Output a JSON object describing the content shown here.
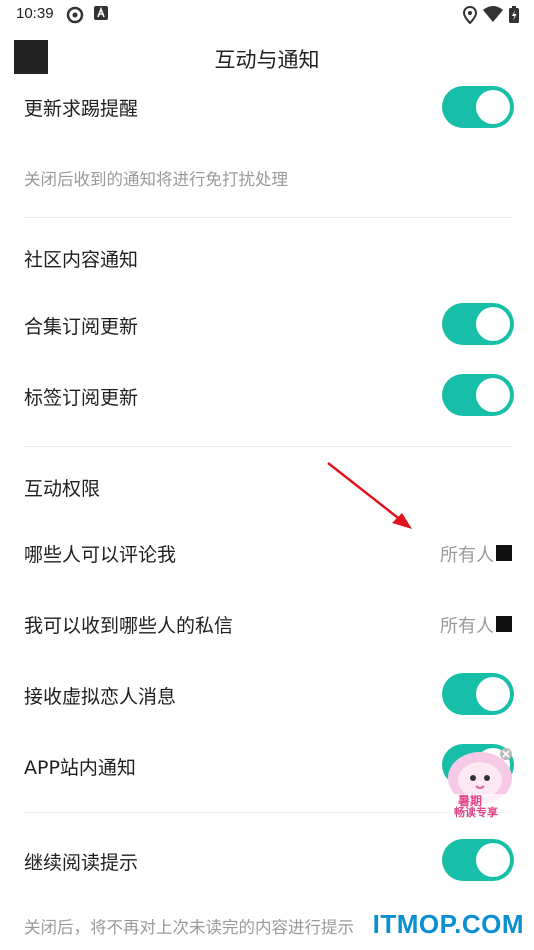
{
  "status_bar": {
    "time": "10:39"
  },
  "header": {
    "title": "互动与通知"
  },
  "rows": {
    "update_reminder": {
      "label": "更新求踢提醒",
      "on": true
    },
    "update_hint": "关闭后收到的通知将进行免打扰处理",
    "community_section": "社区内容通知",
    "collection_update": {
      "label": "合集订阅更新",
      "on": true
    },
    "tag_update": {
      "label": "标签订阅更新",
      "on": true
    },
    "interaction_section": "互动权限",
    "who_can_comment": {
      "label": "哪些人可以评论我",
      "value": "所有人"
    },
    "private_message": {
      "label": "我可以收到哪些人的私信",
      "value": "所有人"
    },
    "virtual_lover": {
      "label": "接收虚拟恋人消息",
      "on": true
    },
    "app_notification": {
      "label": "APP站内通知",
      "on": true
    },
    "continue_reading": {
      "label": "继续阅读提示",
      "on": true
    },
    "continue_hint": "关闭后，将不再对上次未读完的内容进行提示"
  },
  "promo_badge": {
    "line1": "暑期",
    "line2": "畅读专享"
  },
  "watermark": "ITMOP.COM",
  "colors": {
    "accent": "#17bfa8",
    "arrow": "#e0141e",
    "watermark": "#0a8fd0"
  }
}
